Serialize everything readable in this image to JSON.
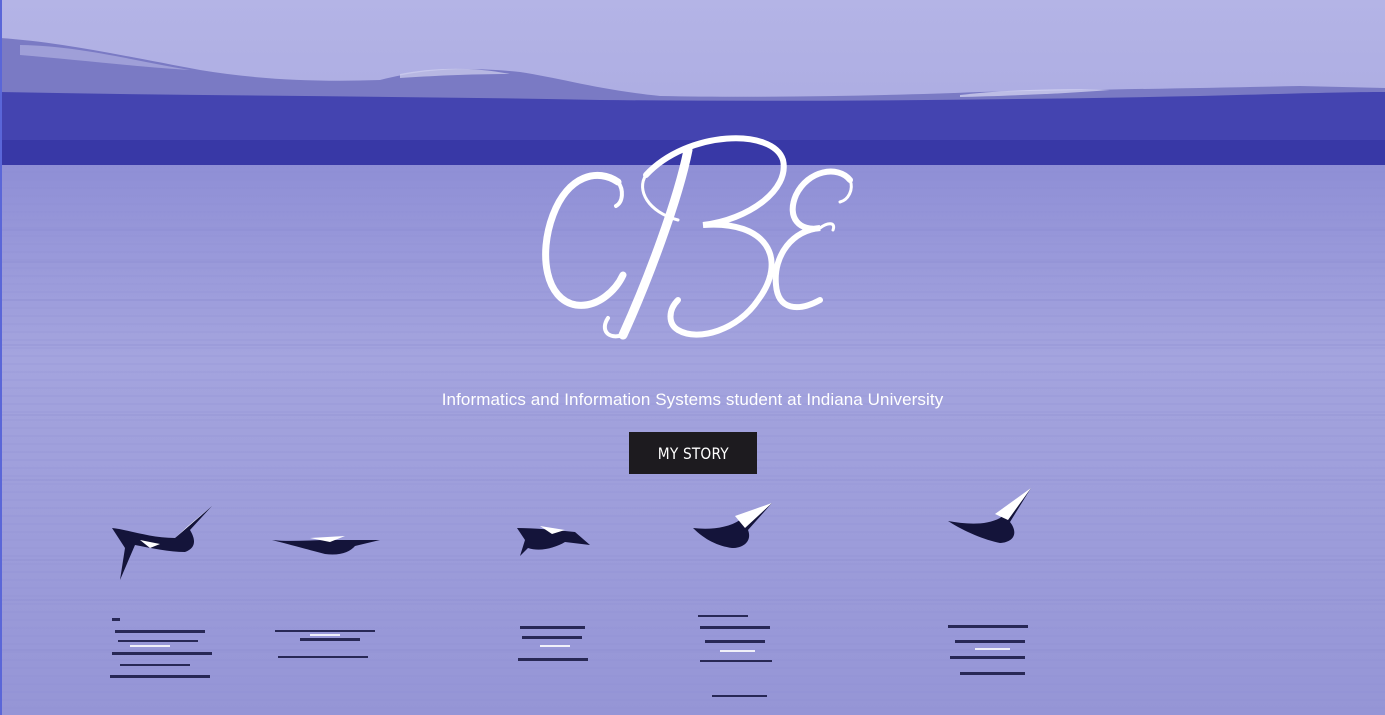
{
  "hero": {
    "monogram": "cBE",
    "tagline": "Informatics and Information Systems student at Indiana University",
    "button_label": "MY STORY",
    "colors": {
      "sky": "#aeaee2",
      "water": "#9b9bd8",
      "mountains_far": "#6f6fbd",
      "shore": "#3d3dad",
      "button_bg": "#1d1b1f",
      "text": "#ffffff"
    }
  }
}
